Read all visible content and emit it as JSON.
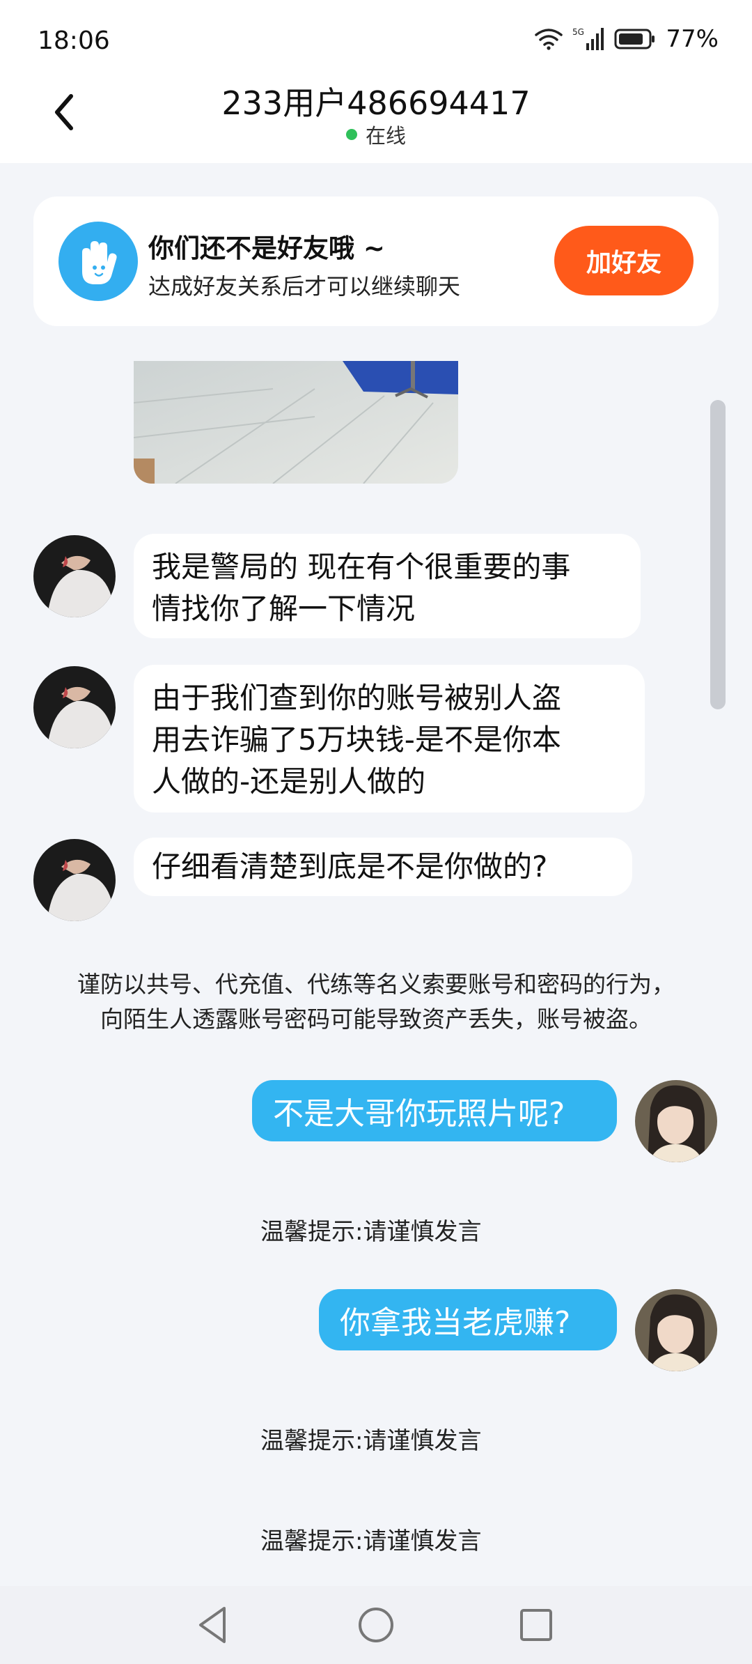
{
  "status_bar": {
    "time": "18:06",
    "network": "5G",
    "battery": "77%",
    "icons": [
      "wifi-icon",
      "signal-icon",
      "battery-icon"
    ]
  },
  "header": {
    "title": "233用户486694417",
    "status": "在线",
    "status_color": "#2fc05a",
    "back_icon": "back-chevron-icon"
  },
  "banner": {
    "title": "你们还不是好友哦 ~",
    "subtitle": "达成好友关系后才可以继续聊天",
    "button_label": "加好友",
    "button_color": "#ff5a1a",
    "icon": "hand-mascot-icon"
  },
  "messages_in": [
    {
      "lines": [
        "我是警局的 现在有个很重要的事",
        "情找你了解一下情况"
      ]
    },
    {
      "lines": [
        "由于我们查到你的账号被别人盗",
        "用去诈骗了5万块钱-是不是你本",
        "人做的-还是别人做的"
      ]
    },
    {
      "lines": [
        "仔细看清楚到底是不是你做的?"
      ]
    }
  ],
  "notice": {
    "line1": "谨防以共号、代充值、代练等名义索要账号和密码的行为，",
    "line2": "向陌生人透露账号密码可能导致资产丢失，账号被盗。"
  },
  "messages_out": [
    {
      "text": "不是大哥你玩照片呢?"
    },
    {
      "text": "你拿我当老虎赚?"
    }
  ],
  "tips": [
    "温馨提示:请谨慎发言",
    "温馨提示:请谨慎发言",
    "温馨提示:请谨慎发言"
  ],
  "colors": {
    "bubble_out": "#33b5f1",
    "background": "#f3f5f9"
  },
  "nav": {
    "icons": [
      "nav-back-icon",
      "nav-home-icon",
      "nav-recents-icon"
    ]
  }
}
